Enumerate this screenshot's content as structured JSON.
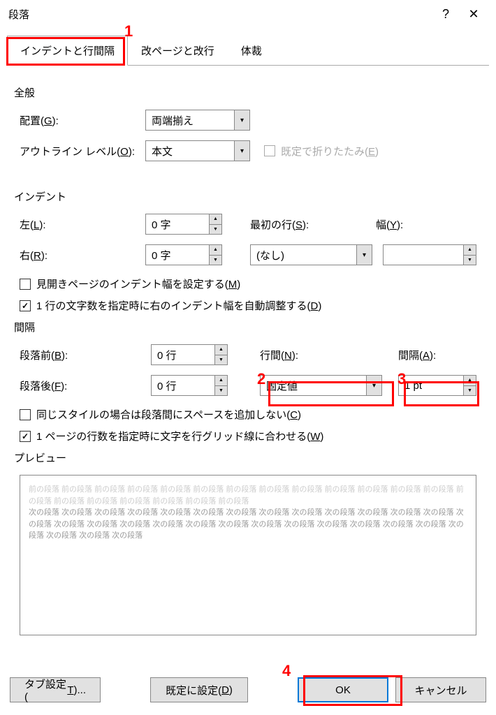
{
  "title": "段落",
  "markers": {
    "m1": "1",
    "m2": "2",
    "m3": "3",
    "m4": "4"
  },
  "tabs": {
    "t1": "インデントと行間隔",
    "t2": "改ページと改行",
    "t3": "体裁"
  },
  "general": {
    "heading": "全般",
    "alignment_label": "配置(G):",
    "alignment_value": "両端揃え",
    "outline_label": "アウトライン レベル(O):",
    "outline_value": "本文",
    "collapsed_label": "既定で折りたたみ(E)"
  },
  "indent": {
    "heading": "インデント",
    "left_label": "左(L):",
    "left_value": "0 字",
    "right_label": "右(R):",
    "right_value": "0 字",
    "firstline_label": "最初の行(S):",
    "firstline_value": "(なし)",
    "width_label": "幅(Y):",
    "width_value": "",
    "mirror_label": "見開きページのインデント幅を設定する(M)",
    "auto_label": "1 行の文字数を指定時に右のインデント幅を自動調整する(D)"
  },
  "spacing": {
    "heading": "間隔",
    "before_label": "段落前(B):",
    "before_value": "0 行",
    "after_label": "段落後(F):",
    "after_value": "0 行",
    "linespacing_label": "行間(N):",
    "linespacing_value": "固定値",
    "at_label": "間隔(A):",
    "at_value": "1 pt",
    "nospace_label": "同じスタイルの場合は段落間にスペースを追加しない(C)",
    "snap_label": "1 ページの行数を指定時に文字を行グリッド線に合わせる(W)"
  },
  "preview": {
    "heading": "プレビュー",
    "prev": "前の段落 ",
    "next": "次の段落 "
  },
  "buttons": {
    "tabs": "タブ設定(T)...",
    "default": "既定に設定(D)",
    "ok": "OK",
    "cancel": "キャンセル"
  }
}
